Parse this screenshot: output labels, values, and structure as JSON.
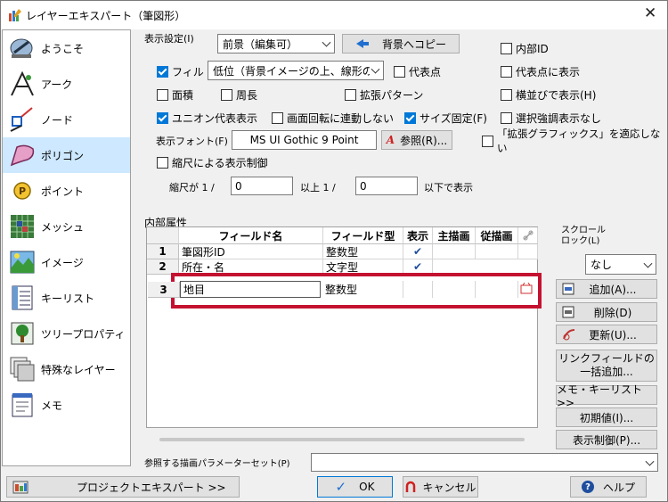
{
  "window": {
    "title": "レイヤーエキスパート（筆図形）"
  },
  "sidebar": {
    "items": [
      {
        "label": "ようこそ",
        "icon": "welcome-icon"
      },
      {
        "label": "アーク",
        "icon": "arc-icon"
      },
      {
        "label": "ノード",
        "icon": "node-icon"
      },
      {
        "label": "ポリゴン",
        "icon": "polygon-icon",
        "active": true
      },
      {
        "label": "ポイント",
        "icon": "point-icon"
      },
      {
        "label": "メッシュ",
        "icon": "mesh-icon"
      },
      {
        "label": "イメージ",
        "icon": "image-icon"
      },
      {
        "label": "キーリスト",
        "icon": "keylist-icon"
      },
      {
        "label": "ツリープロパティ",
        "icon": "tree-property-icon"
      },
      {
        "label": "特殊なレイヤー",
        "icon": "special-layer-icon"
      },
      {
        "label": "メモ",
        "icon": "memo-icon"
      }
    ]
  },
  "display": {
    "section_label": "表示設定(I)",
    "mode_value": "前景（編集可）",
    "copy_to_bg_label": "背景へコピー",
    "fill_label": "フィル",
    "fill_checked": true,
    "fill_order_value": "低位（背景イメージの上、線形の",
    "rep_point_label": "代表点",
    "rep_point_checked": false,
    "area_label": "面積",
    "perimeter_label": "周長",
    "ext_pattern_label": "拡張パターン",
    "union_label": "ユニオン代表表示",
    "union_checked": true,
    "rotate_label": "画面回転に連動しない",
    "size_fixed_label": "サイズ固定(F)",
    "size_fixed_checked": true,
    "font_label": "表示フォント(F)",
    "font_value": "MS UI Gothic 9 Point",
    "browse_label": "参照(R)...",
    "scale_control_label": "縮尺による表示制御",
    "scale_prefix": "縮尺が 1 /",
    "scale_min": "0",
    "scale_mid": "以上 1 /",
    "scale_max": "0",
    "scale_suffix": "以下で表示",
    "inner_id_label": "内部ID",
    "show_on_rep_label": "代表点に表示",
    "horizontal_label": "横並びで表示(H)",
    "no_select_highlight_label": "選択強調表示なし",
    "ext_graphics_label": "「拡張グラフィックス」を適応しない"
  },
  "attributes": {
    "section_label": "内部属性",
    "columns": [
      "フィールド名",
      "フィールド型",
      "表示",
      "主描画",
      "従描画"
    ],
    "rows": [
      {
        "num": "1",
        "name": "筆図形ID",
        "type": "整数型",
        "show": "✔"
      },
      {
        "num": "2",
        "name": "所在・名",
        "type": "文字型",
        "show": "✔"
      },
      {
        "num": "3",
        "name": "地目",
        "type": "整数型",
        "show": ""
      }
    ],
    "scroll_lock_label": "スクロール\nロック(L)",
    "scroll_lock_value": "なし",
    "add_label": "追加(A)...",
    "delete_label": "削除(D)",
    "update_label": "更新(U)...",
    "link_add_label": "リンクフィールドの\n一括追加...",
    "memo_keylist_label": "メモ・キーリスト >>",
    "initial_label": "初期値(I)...",
    "display_control_label": "表示制御(P)..."
  },
  "param_set": {
    "label": "参照する描画パラメーターセット(P)",
    "value": ""
  },
  "footer": {
    "project_label": "プロジェクトエキスパート >>",
    "ok_label": "OK",
    "cancel_label": "キャンセル",
    "help_label": "ヘルプ"
  }
}
